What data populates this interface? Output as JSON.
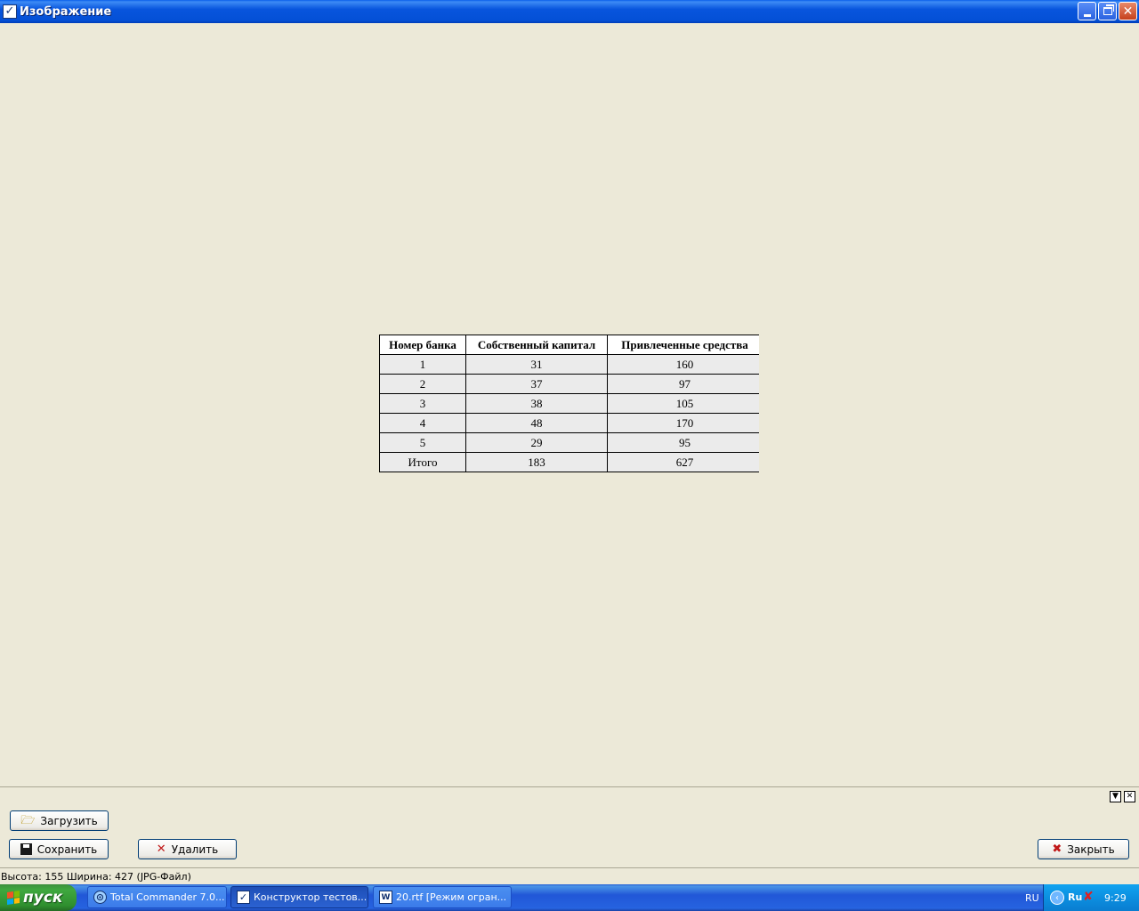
{
  "window": {
    "title": "Изображение",
    "icon": "checkbox-icon",
    "controls": [
      "minimize-icon",
      "restore-icon",
      "close-icon"
    ]
  },
  "image_table": {
    "headers": [
      "Номер банка",
      "Собственный капитал",
      "Привлеченные средства"
    ],
    "rows": [
      [
        "1",
        "31",
        "160"
      ],
      [
        "2",
        "37",
        "97"
      ],
      [
        "3",
        "38",
        "105"
      ],
      [
        "4",
        "48",
        "170"
      ],
      [
        "5",
        "29",
        "95"
      ],
      [
        "Итого",
        "183",
        "627"
      ]
    ]
  },
  "panel": {
    "load_label": "Загрузить",
    "save_label": "Сохранить",
    "delete_label": "Удалить",
    "close_label": "Закрыть"
  },
  "status": {
    "text": "Высота: 155  Ширина: 427   (JPG-Файл)"
  },
  "taskbar": {
    "start_label": "пуск",
    "tasks": [
      {
        "label": "Total Commander 7.0...",
        "icon": "total-commander-icon",
        "active": false
      },
      {
        "label": "Конструктор тестов...",
        "icon": "checkbox-icon",
        "active": true
      },
      {
        "label": "20.rtf [Режим огран...",
        "icon": "document-icon",
        "active": false
      }
    ],
    "language": "RU",
    "tray_lang": "Ru",
    "clock": "9:29"
  },
  "colors": {
    "window_bg": "#ECE9D8",
    "titlebar": "#0855DD",
    "taskbar": "#2157D7",
    "start_green": "#3FA83F",
    "cell_bg": "#EBEBEB"
  }
}
